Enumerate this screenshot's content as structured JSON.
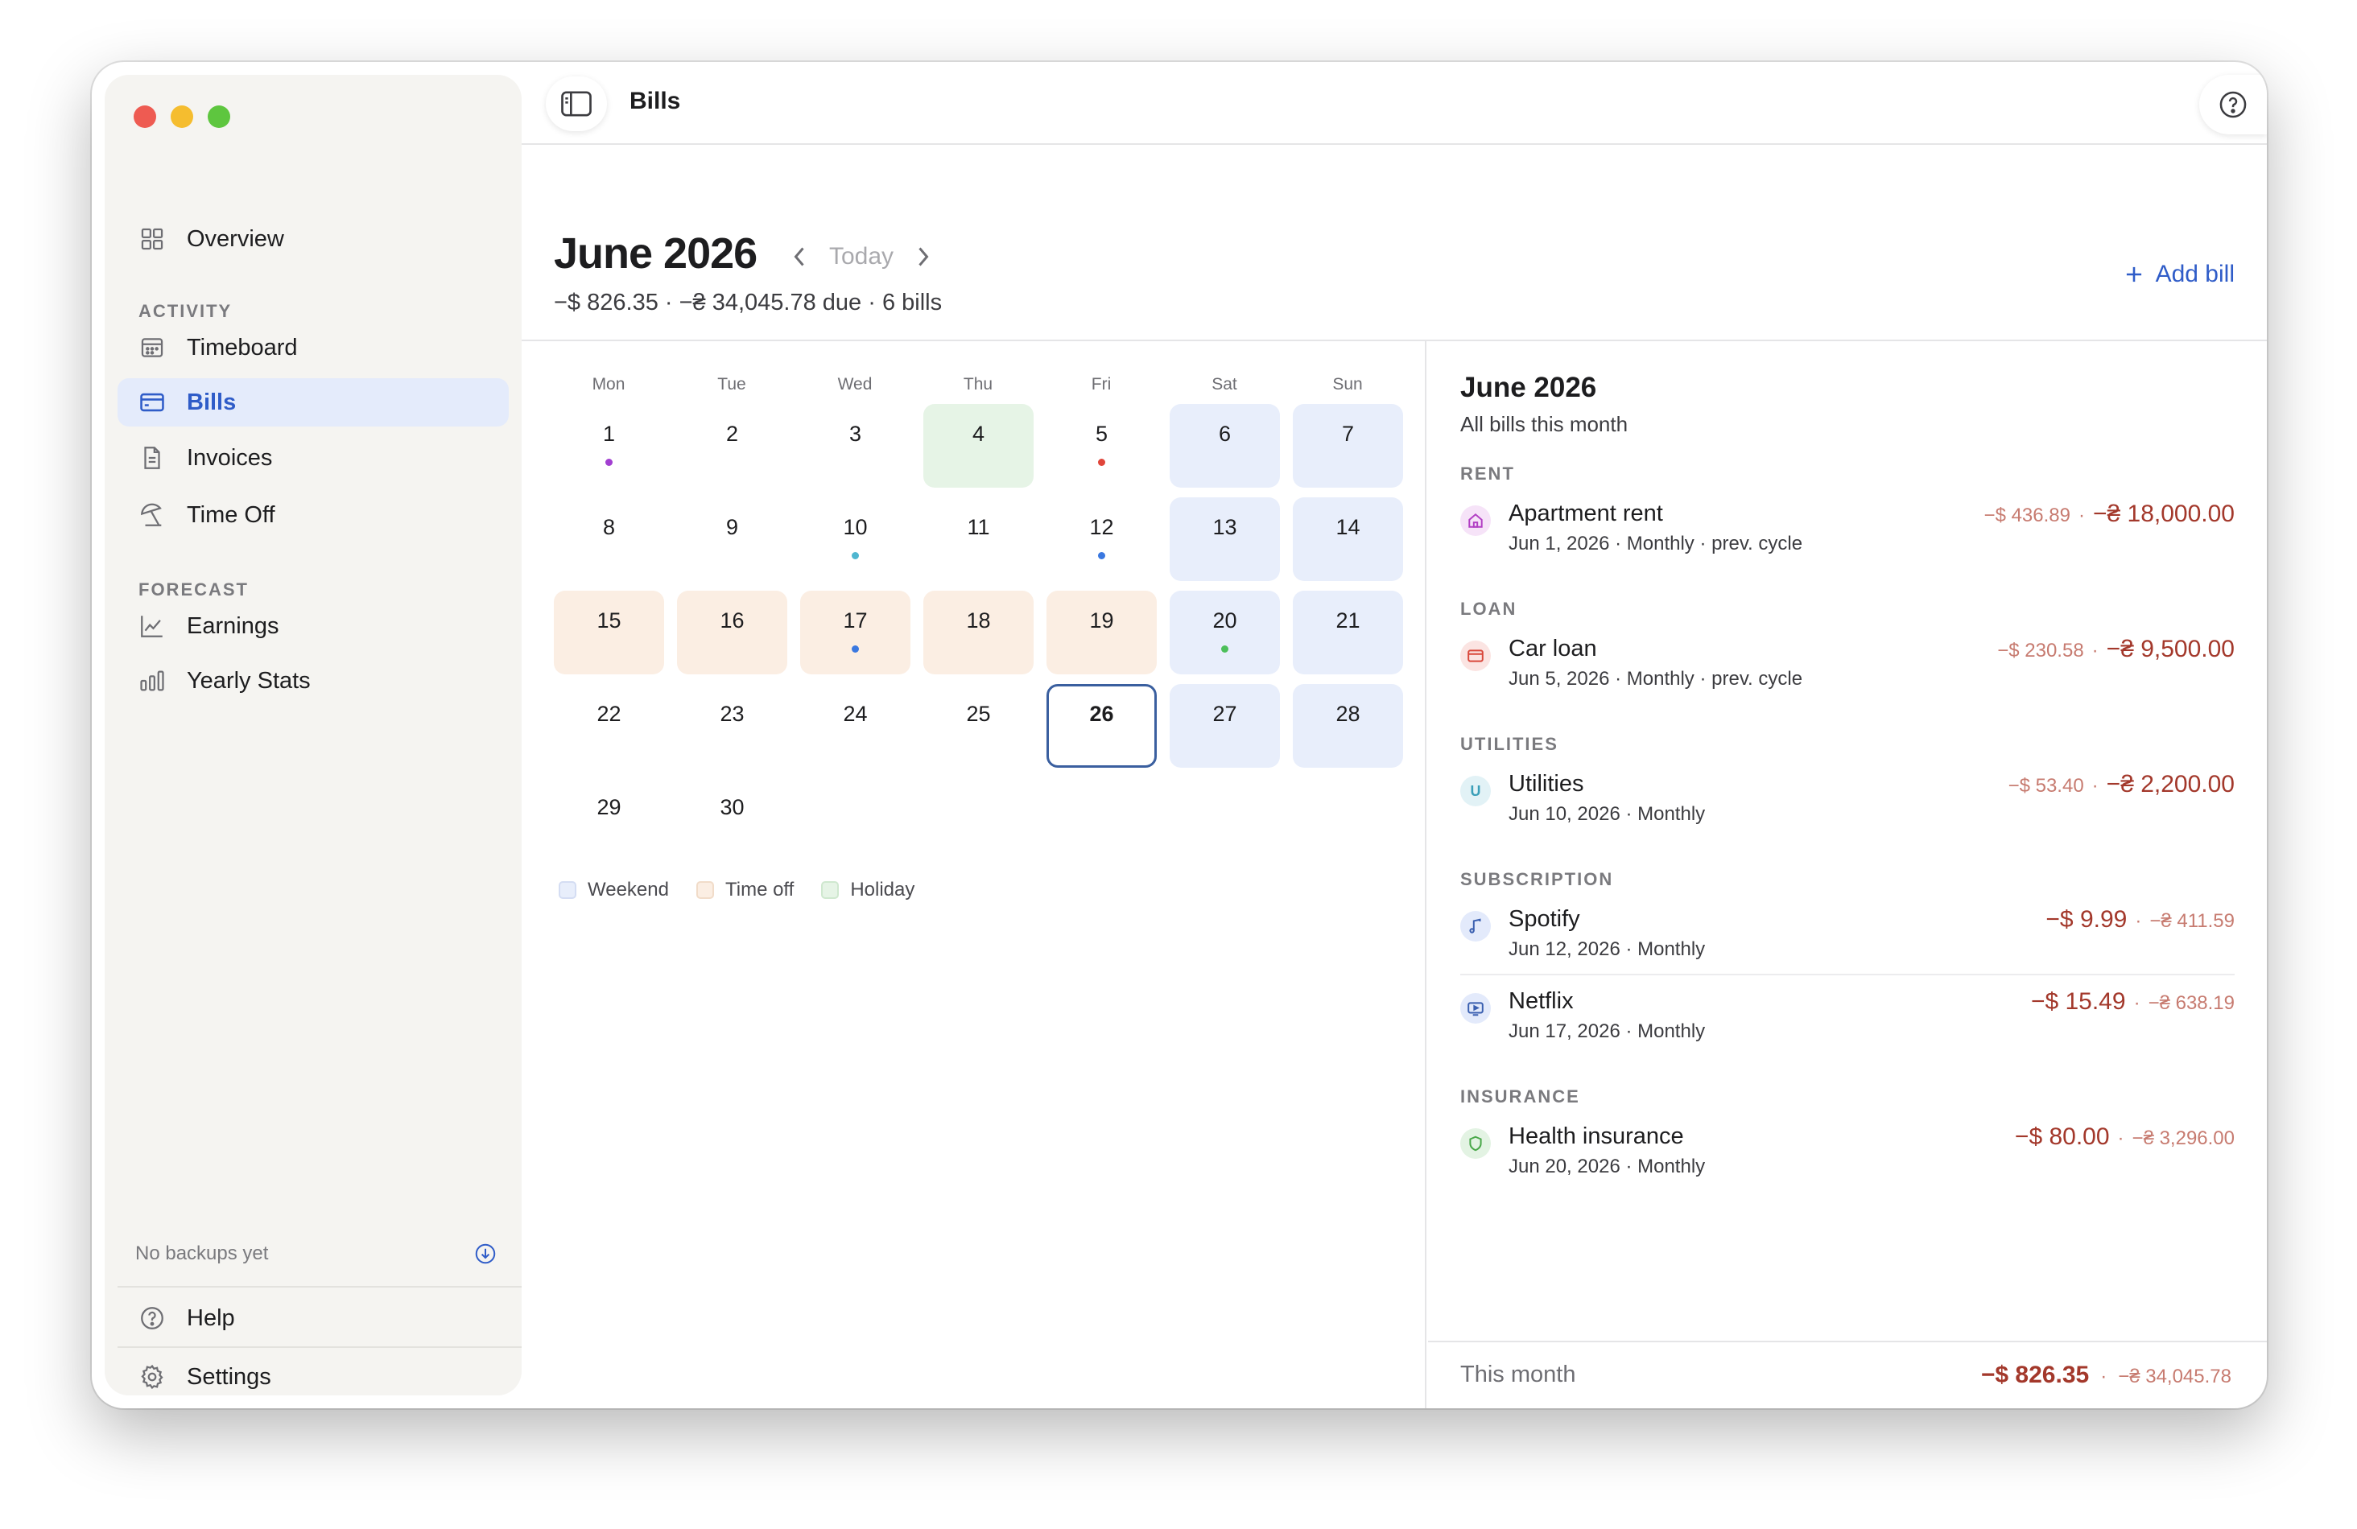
{
  "sidebar": {
    "items": {
      "overview": "Overview",
      "timeboard": "Timeboard",
      "bills": "Bills",
      "invoices": "Invoices",
      "timeoff": "Time Off",
      "earnings": "Earnings",
      "yearly": "Yearly Stats",
      "help": "Help",
      "settings": "Settings"
    },
    "sections": {
      "activity": "ACTIVITY",
      "forecast": "FORECAST"
    },
    "backup_status": "No backups yet"
  },
  "topbar": {
    "title": "Bills"
  },
  "header": {
    "month": "June 2026",
    "today_label": "Today",
    "summary": "−$ 826.35 · −₴ 34,045.78 due · 6 bills",
    "add_bill": "Add bill"
  },
  "calendar": {
    "weekdays": [
      "Mon",
      "Tue",
      "Wed",
      "Thu",
      "Fri",
      "Sat",
      "Sun"
    ],
    "days": [
      {
        "n": "1",
        "type": "",
        "dot": "#a23fd1"
      },
      {
        "n": "2",
        "type": "",
        "dot": ""
      },
      {
        "n": "3",
        "type": "",
        "dot": ""
      },
      {
        "n": "4",
        "type": "holiday",
        "dot": ""
      },
      {
        "n": "5",
        "type": "",
        "dot": "#e0453a"
      },
      {
        "n": "6",
        "type": "weekend",
        "dot": ""
      },
      {
        "n": "7",
        "type": "weekend",
        "dot": ""
      },
      {
        "n": "8",
        "type": "",
        "dot": ""
      },
      {
        "n": "9",
        "type": "",
        "dot": ""
      },
      {
        "n": "10",
        "type": "",
        "dot": "#4fb6d0"
      },
      {
        "n": "11",
        "type": "",
        "dot": ""
      },
      {
        "n": "12",
        "type": "",
        "dot": "#3a78e0"
      },
      {
        "n": "13",
        "type": "weekend",
        "dot": ""
      },
      {
        "n": "14",
        "type": "weekend",
        "dot": ""
      },
      {
        "n": "15",
        "type": "timeoff",
        "dot": ""
      },
      {
        "n": "16",
        "type": "timeoff",
        "dot": ""
      },
      {
        "n": "17",
        "type": "timeoff",
        "dot": "#3a78e0"
      },
      {
        "n": "18",
        "type": "timeoff",
        "dot": ""
      },
      {
        "n": "19",
        "type": "timeoff",
        "dot": ""
      },
      {
        "n": "20",
        "type": "weekend",
        "dot": "#4cbf5a"
      },
      {
        "n": "21",
        "type": "weekend",
        "dot": ""
      },
      {
        "n": "22",
        "type": "",
        "dot": ""
      },
      {
        "n": "23",
        "type": "",
        "dot": ""
      },
      {
        "n": "24",
        "type": "",
        "dot": ""
      },
      {
        "n": "25",
        "type": "",
        "dot": ""
      },
      {
        "n": "26",
        "type": "today",
        "dot": ""
      },
      {
        "n": "27",
        "type": "weekend",
        "dot": ""
      },
      {
        "n": "28",
        "type": "weekend",
        "dot": ""
      },
      {
        "n": "29",
        "type": "",
        "dot": ""
      },
      {
        "n": "30",
        "type": "",
        "dot": ""
      }
    ],
    "legend": {
      "weekend": "Weekend",
      "timeoff": "Time off",
      "holiday": "Holiday"
    }
  },
  "panel": {
    "title": "June 2026",
    "subtitle": "All bills this month",
    "categories": {
      "rent": "RENT",
      "loan": "LOAN",
      "utilities": "UTILITIES",
      "subscription": "SUBSCRIPTION",
      "insurance": "INSURANCE"
    },
    "bills": {
      "rent": {
        "name": "Apartment rent",
        "meta": "Jun 1, 2026 · Monthly · prev. cycle",
        "usd": "−$ 436.89",
        "uah": "−₴ 18,000.00",
        "icon": "home-icon"
      },
      "loan": {
        "name": "Car loan",
        "meta": "Jun 5, 2026 · Monthly · prev. cycle",
        "usd": "−$ 230.58",
        "uah": "−₴ 9,500.00",
        "icon": "card-icon"
      },
      "utilities": {
        "name": "Utilities",
        "meta": "Jun 10, 2026 · Monthly",
        "usd": "−$ 53.40",
        "uah": "−₴ 2,200.00",
        "icon": "utilities-badge-icon",
        "badge": "U"
      },
      "spotify": {
        "name": "Spotify",
        "meta": "Jun 12, 2026 · Monthly",
        "usd": "−$ 9.99",
        "uah": "−₴ 411.59",
        "icon": "music-note-icon"
      },
      "netflix": {
        "name": "Netflix",
        "meta": "Jun 17, 2026 · Monthly",
        "usd": "−$ 15.49",
        "uah": "−₴ 638.19",
        "icon": "tv-icon"
      },
      "health": {
        "name": "Health insurance",
        "meta": "Jun 20, 2026 · Monthly",
        "usd": "−$ 80.00",
        "uah": "−₴ 3,296.00",
        "icon": "shield-icon"
      }
    },
    "footer": {
      "label": "This month",
      "usd": "−$ 826.35",
      "uah": "−₴ 34,045.78"
    }
  }
}
